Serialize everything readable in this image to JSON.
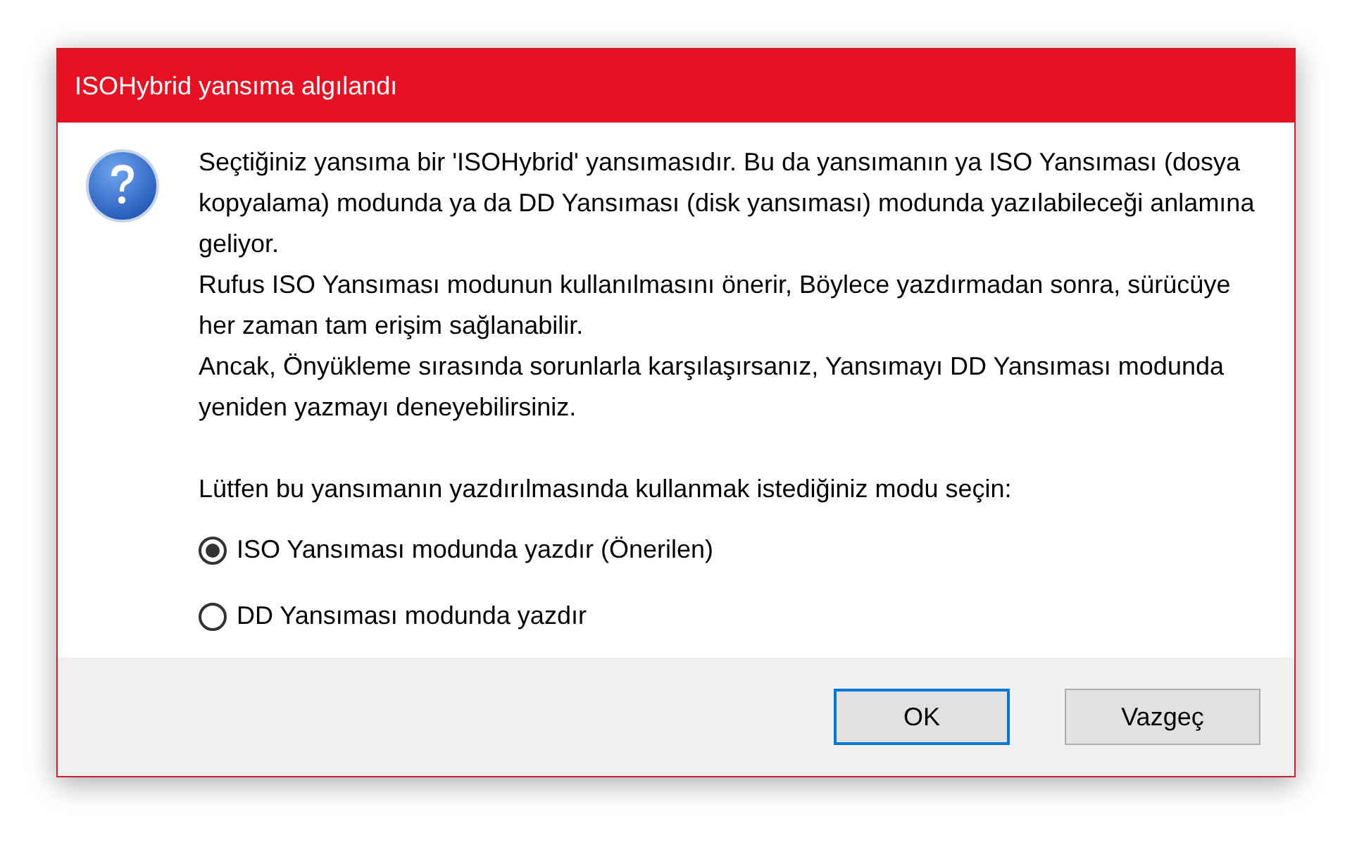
{
  "window": {
    "title": "ISOHybrid yansıma algılandı"
  },
  "message": {
    "paragraphs": [
      "Seçtiğiniz yansıma bir 'ISOHybrid' yansımasıdır. Bu da yansımanın ya ISO Yansıması (dosya kopyalama) modunda ya da DD Yansıması (disk yansıması) modunda yazılabileceği anlamına geliyor.",
      "Rufus ISO Yansıması modunun kullanılmasını önerir, Böylece yazdırmadan sonra, sürücüye her zaman tam erişim sağlanabilir.",
      "Ancak, Önyükleme sırasında sorunlarla karşılaşırsanız, Yansımayı DD Yansıması modunda yeniden yazmayı deneyebilirsiniz."
    ],
    "prompt": "Lütfen bu yansımanın yazdırılmasında kullanmak istediğiniz modu seçin:"
  },
  "options": [
    {
      "label": "ISO Yansıması modunda yazdır (Önerilen)",
      "selected": true
    },
    {
      "label": "DD Yansıması modunda yazdır",
      "selected": false
    }
  ],
  "buttons": [
    {
      "label": "OK",
      "default": true
    },
    {
      "label": "Vazgeç",
      "default": false
    }
  ]
}
